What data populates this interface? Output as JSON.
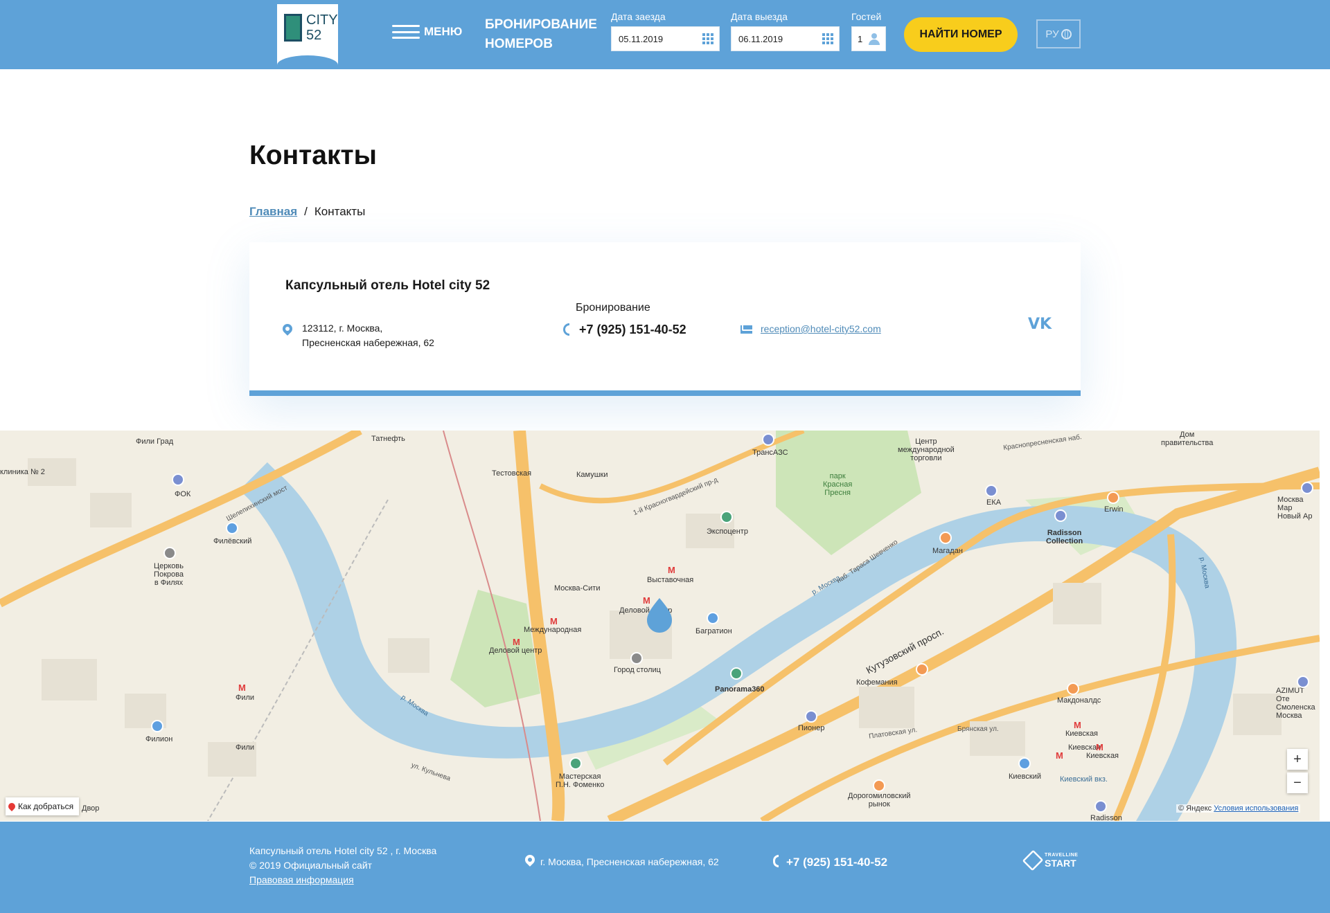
{
  "header": {
    "logo_text": "CITY\n52",
    "menu_label": "МЕНЮ",
    "booking_title": "БРОНИРОВАНИЕ НОМЕРОВ",
    "checkin_label": "Дата заезда",
    "checkin_value": "05.11.2019",
    "checkout_label": "Дата выезда",
    "checkout_value": "06.11.2019",
    "guests_label": "Гостей",
    "guests_value": "1",
    "find_button": "НАЙТИ НОМЕР",
    "lang": "РУ"
  },
  "page": {
    "title": "Контакты",
    "breadcrumb": {
      "home": "Главная",
      "separator": "/",
      "current": "Контакты"
    }
  },
  "contacts": {
    "hotel_name": "Капсульный отель Hotel city 52",
    "address_line1": "123112, г. Москва,",
    "address_line2": "Пресненская набережная, 62",
    "booking_label": "Бронирование",
    "phone": "+7 (925) 151-40-52",
    "email": "reception@hotel-city52.com",
    "social_icon": "vk-icon"
  },
  "map": {
    "labels": {
      "fili_grad": "Фили Град",
      "tatneft": "Татнефть",
      "klinika": "клиника № 2",
      "fok": "ФОК",
      "shelepikhinsky": "Шелепихинский мост",
      "filevsky": "Филёвский",
      "church": "Церковь\nПокрова\nв Филях",
      "testovskaya": "Тестовская",
      "kamushki": "Камушки",
      "transazs": "ТрансАЗС",
      "trade_center": "Центр\nмеждународной\nторговли",
      "dom_prav": "Дом\nправительства",
      "krasnopresnenskaya": "Краснопресненская наб.",
      "park": "парк\nКрасная\nПресня",
      "krasnogvard": "1-й Красногвардейский пр-д",
      "expocentr": "Экспоцентр",
      "moskva_siti": "Москва-Сити",
      "vystavochnaya": "Выставочная",
      "delovoy": "Деловой центр",
      "mezhdunarodnaya": "Международная",
      "delovoy2": "Деловой центр",
      "bagration": "Багратион",
      "gorod_stolits": "Город столиц",
      "panorama": "Panorama360",
      "eka": "ЕКА",
      "radisson": "Radisson\nCollection",
      "erwin": "Erwin",
      "magadan": "Магадан",
      "r_moskva": "р. Москва",
      "r_moskva2": "р. Москва",
      "r_moskva3": "р. Москва",
      "shevchenko": "наб. Тараса Шевченко",
      "kutuzovsky": "Кутузовский просп.",
      "kofemaniya": "Кофемания",
      "makdonalds": "Макдоналдс",
      "fili": "Фили",
      "filion": "Филион",
      "fili2": "Фили",
      "pioner": "Пионер",
      "kievskaya": "Киевская",
      "kievskaya2": "Киевская",
      "kievskaya3": "Киевская",
      "kievskiy": "Киевский",
      "kievskiy_vokzal": "Киевский вкз.",
      "masterskaya": "Мастерская\nП.Н. Фоменко",
      "dorogomilovsky": "Дорогомиловский\nрынок",
      "radisson2": "Radisson",
      "azimut": "AZIMUT Оте\nСмоленска\nМосква",
      "moskva_mar": "Москва Мар\nНовый Ар",
      "bryanskaya": "Брянская ул.",
      "platovskaya": "Платовская ул.",
      "kulneva": "ул. Кульнева",
      "dvor": "Двор"
    },
    "route_button": "Как добраться",
    "copyright": "© Яндекс",
    "terms": "Условия использования",
    "zoom_in": "+",
    "zoom_out": "−"
  },
  "footer": {
    "line1": "Капсульный отель Hotel city 52 , г. Москва",
    "line2": "© 2019 Официальный сайт",
    "legal_link": "Правовая информация",
    "address": "г. Москва, Пресненская набережная, 62",
    "phone": "+7 (925) 151-40-52",
    "partner_small": "TRAVELLINE",
    "partner_big": "START"
  },
  "colors": {
    "brand": "#5ea2d8",
    "accent": "#f8cd1c",
    "link": "#4f8bb8"
  }
}
